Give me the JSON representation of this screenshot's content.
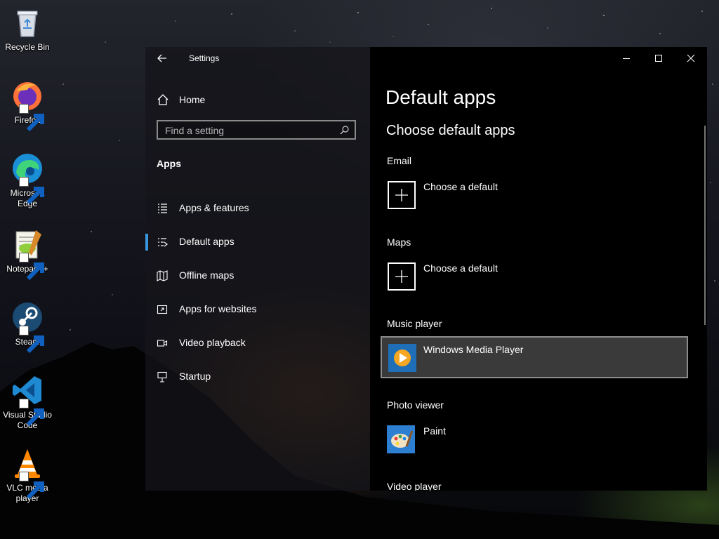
{
  "desktop": {
    "icons": [
      {
        "label": "Recycle Bin",
        "name": "recycle-bin-icon"
      },
      {
        "label": "Firefox",
        "name": "firefox-icon"
      },
      {
        "label": "Microsoft Edge",
        "name": "edge-icon"
      },
      {
        "label": "Notepad++",
        "name": "notepadpp-icon"
      },
      {
        "label": "Steam",
        "name": "steam-icon"
      },
      {
        "label": "Visual Studio Code",
        "name": "vscode-icon"
      },
      {
        "label": "VLC media player",
        "name": "vlc-icon"
      }
    ]
  },
  "window": {
    "title": "Settings",
    "home_label": "Home",
    "search": {
      "placeholder": "Find a setting"
    },
    "section": "Apps",
    "nav_items": [
      {
        "label": "Apps & features",
        "icon": "list-icon",
        "selected": false
      },
      {
        "label": "Default apps",
        "icon": "default-apps-icon",
        "selected": true
      },
      {
        "label": "Offline maps",
        "icon": "map-icon",
        "selected": false
      },
      {
        "label": "Apps for websites",
        "icon": "open-in-app-icon",
        "selected": false
      },
      {
        "label": "Video playback",
        "icon": "video-icon",
        "selected": false
      },
      {
        "label": "Startup",
        "icon": "startup-icon",
        "selected": false
      }
    ]
  },
  "content": {
    "title": "Default apps",
    "subtitle": "Choose default apps",
    "categories": [
      {
        "label": "Email",
        "app": "Choose a default",
        "icon": "plus-icon"
      },
      {
        "label": "Maps",
        "app": "Choose a default",
        "icon": "plus-icon"
      },
      {
        "label": "Music player",
        "app": "Windows Media Player",
        "icon": "windows-media-player-icon"
      },
      {
        "label": "Photo viewer",
        "app": "Paint",
        "icon": "paint-icon"
      },
      {
        "label": "Video player",
        "app": "",
        "icon": ""
      }
    ]
  },
  "colors": {
    "accent": "#3a96dd",
    "content_bg": "#000000",
    "highlight_bg": "#3a3a3a"
  }
}
